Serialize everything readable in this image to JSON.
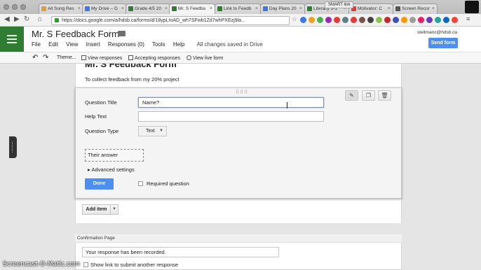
{
  "browser": {
    "tabs": [
      {
        "label": "All Song Res",
        "color": "#e0a030"
      },
      {
        "label": "My Drive – G",
        "color": "#3b78e7"
      },
      {
        "label": "Grade 4/5 20",
        "color": "#2e7d32"
      },
      {
        "label": "Mr. S Feedba",
        "color": "#2e7d32"
      },
      {
        "label": "Link to Feedb",
        "color": "#2e7d32"
      },
      {
        "label": "Day Plans 20",
        "color": "#3b78e7"
      },
      {
        "label": "Literacy 3-1",
        "color": "#2e7d32"
      },
      {
        "label": "Motivator: C",
        "color": "#e53935"
      },
      {
        "label": "Screen Recor",
        "color": "#555555"
      }
    ],
    "smart_link": "SMART link",
    "url": "https://docs.google.com/a/hdsb.ca/forms/d/18ypLInAD_wh7SFwb1Zd7whPXEzj9la..."
  },
  "app": {
    "title": "Mr. S Feedback Form",
    "menu": [
      "File",
      "Edit",
      "View",
      "Insert",
      "Responses (0)",
      "Tools",
      "Help"
    ],
    "save_status": "All changes saved in Drive",
    "user_email": "steltmanc@hdsb.ca",
    "send_form": "Send form"
  },
  "editor_toolbar": {
    "theme": "Theme...",
    "view_responses": "View responses",
    "accepting": "Accepting responses",
    "view_live": "View live form"
  },
  "form": {
    "title": "Mr. S Feedback Form",
    "description": "To collect feedback from my 20% project",
    "question": {
      "title_label": "Question Title",
      "title_value": "Name?",
      "help_label": "Help Text",
      "help_value": "",
      "type_label": "Question Type",
      "type_value": "Text",
      "answer_placeholder": "Their answer",
      "advanced": "Advanced settings",
      "done": "Done",
      "required_label": "Required question"
    },
    "add_item": "Add item",
    "confirmation": {
      "header": "Confirmation Page",
      "message": "Your response has been recorded.",
      "show_link": "Show link to submit another response"
    }
  },
  "watermark": "Screencast-O-Matic.com"
}
